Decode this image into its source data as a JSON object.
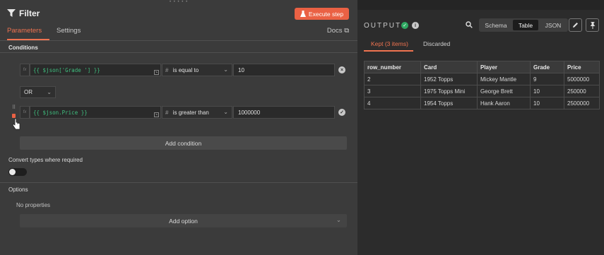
{
  "node": {
    "title": "Filter",
    "execute_label": "Execute step",
    "tabs": [
      "Parameters",
      "Settings"
    ],
    "docs_label": "Docs"
  },
  "conditions": {
    "label": "Conditions",
    "rows": [
      {
        "expression": "{{ $json['Grade '] }}",
        "operator": "is equal to",
        "value": "10"
      },
      {
        "expression": "{{ $json.Price }}",
        "operator": "is greater than",
        "value": "1000000"
      }
    ],
    "combinator": "OR",
    "add_label": "Add condition"
  },
  "convert": {
    "label": "Convert types where required",
    "enabled": false
  },
  "options": {
    "label": "Options",
    "empty_text": "No properties",
    "add_label": "Add option"
  },
  "output": {
    "title": "OUTPUT",
    "views": [
      "Schema",
      "Table",
      "JSON"
    ],
    "active_view": "Table",
    "tabs": [
      "Kept (3 items)",
      "Discarded"
    ],
    "columns": [
      "row_number",
      "Card",
      "Player",
      "Grade",
      "Price"
    ],
    "rows": [
      [
        "2",
        "1952 Topps",
        "Mickey Mantle",
        "9",
        "5000000"
      ],
      [
        "3",
        "1975 Topps Mini",
        "George Brett",
        "10",
        "250000"
      ],
      [
        "4",
        "1954 Topps",
        "Hank Aaron",
        "10",
        "2500000"
      ]
    ]
  },
  "colors": {
    "accent": "#ea6144",
    "success": "#2fa862",
    "expression_green": "#3fbf7f"
  }
}
